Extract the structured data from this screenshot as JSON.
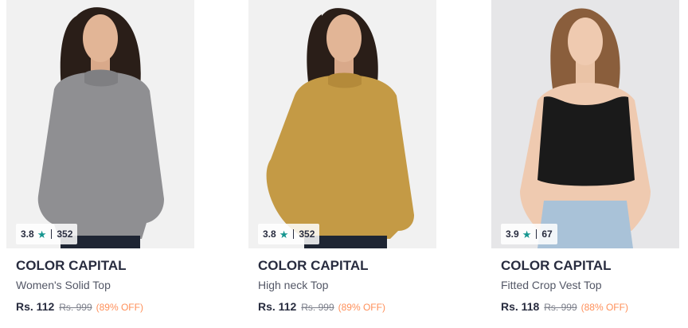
{
  "colors": {
    "star": "#14958f",
    "discount": "#ff905a",
    "brand_text": "#282c3f"
  },
  "products": [
    {
      "brand": "COLOR CAPITAL",
      "name": "Women's Solid Top",
      "rating": "3.8",
      "rating_count": "352",
      "price": "Rs. 112",
      "mrp": "Rs. 999",
      "discount": "(89% OFF)",
      "garment_color": "#8f8f92"
    },
    {
      "brand": "COLOR CAPITAL",
      "name": "High neck Top",
      "rating": "3.8",
      "rating_count": "352",
      "price": "Rs. 112",
      "mrp": "Rs. 999",
      "discount": "(89% OFF)",
      "garment_color": "#c49a45"
    },
    {
      "brand": "COLOR CAPITAL",
      "name": "Fitted Crop Vest Top",
      "rating": "3.9",
      "rating_count": "67",
      "price": "Rs. 118",
      "mrp": "Rs. 999",
      "discount": "(88% OFF)",
      "garment_color": "#1a1a1a"
    }
  ]
}
